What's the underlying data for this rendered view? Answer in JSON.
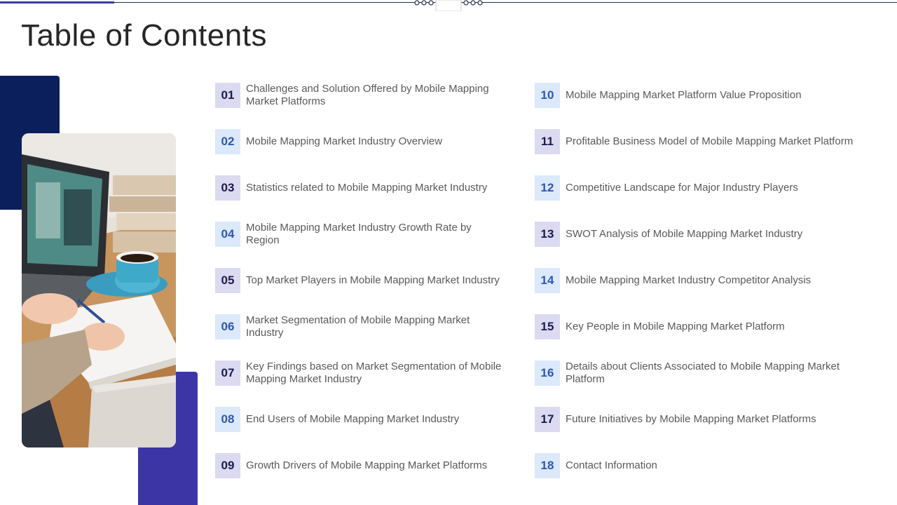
{
  "title": "Table of Contents",
  "colors": {
    "navy": "#0b1f5c",
    "indigo": "#3b35a6",
    "light_box": "#dbe9fb",
    "lavender_box": "#dcdaf1"
  },
  "photo": {
    "description_icon": "laptop-desk-photo"
  },
  "items": [
    {
      "num": "01",
      "label": "Challenges and Solution Offered by Mobile  Mapping Market Platforms"
    },
    {
      "num": "02",
      "label": "Mobile  Mapping  Market Industry Overview"
    },
    {
      "num": "03",
      "label": "Statistics related to Mobile Mapping Market Industry"
    },
    {
      "num": "04",
      "label": "Mobile  Mapping  Market Industry Growth Rate by Region"
    },
    {
      "num": "05",
      "label": "Top Market Players in Mobile  Mapping  Market Industry"
    },
    {
      "num": "06",
      "label": "Market Segmentation of Mobile  Mapping  Market Industry"
    },
    {
      "num": "07",
      "label": "Key Findings based on Market Segmentation of Mobile Mapping Market Industry"
    },
    {
      "num": "08",
      "label": "End Users of Mobile Mapping Market Industry"
    },
    {
      "num": "09",
      "label": "Growth Drivers of Mobile  Mapping  Market Platforms"
    },
    {
      "num": "10",
      "label": "Mobile  Mapping  Market Platform Value Proposition"
    },
    {
      "num": "11",
      "label": "Profitable Business Model  of Mobile Mapping Market Platform"
    },
    {
      "num": "12",
      "label": "Competitive Landscape for Major Industry Players"
    },
    {
      "num": "13",
      "label": "SWOT Analysis of Mobile Mapping  Market Industry"
    },
    {
      "num": "14",
      "label": "Mobile  Mapping  Market Industry Competitor Analysis"
    },
    {
      "num": "15",
      "label": "Key People in Mobile  Mapping  Market Platform"
    },
    {
      "num": "16",
      "label": "Details about Clients Associated to Mobile  Mapping  Market  Platform"
    },
    {
      "num": "17",
      "label": "Future Initiatives  by Mobile  Mapping  Market Platforms"
    },
    {
      "num": "18",
      "label": "Contact Information"
    }
  ]
}
